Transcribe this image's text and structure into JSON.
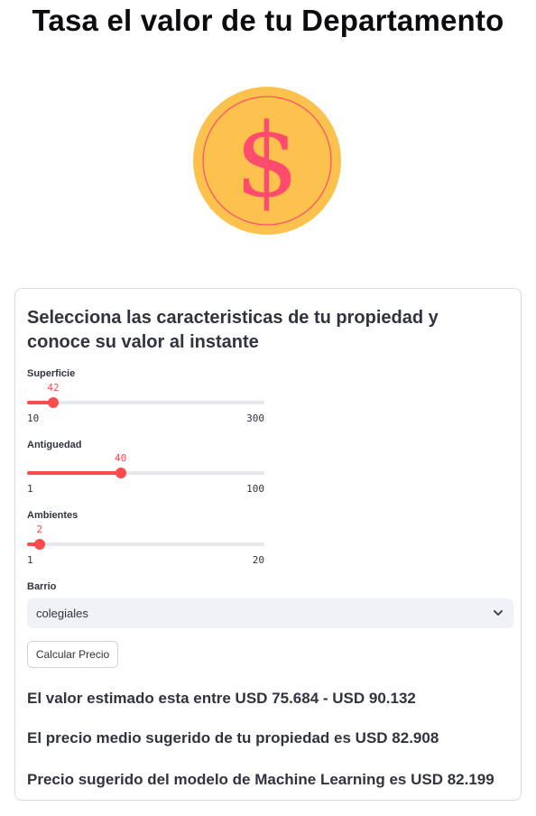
{
  "page": {
    "title": "Tasa el valor de tu Departamento",
    "image_icon": "dollar-coin-icon",
    "image_colors": {
      "coin": "#fcc24d",
      "symbol": "#ff4b6e"
    }
  },
  "form": {
    "heading": "Selecciona las caracteristicas de tu propiedad y conoce su valor al instante",
    "accent_color": "#ff4b4b",
    "sliders": [
      {
        "label": "Superficie",
        "value": 42,
        "min": 10,
        "max": 300
      },
      {
        "label": "Antiguedad",
        "value": 40,
        "min": 1,
        "max": 100
      },
      {
        "label": "Ambientes",
        "value": 2,
        "min": 1,
        "max": 20
      }
    ],
    "barrio": {
      "label": "Barrio",
      "selected": "colegiales",
      "icon": "chevron-down-icon"
    },
    "button_label": "Calcular Precio"
  },
  "results": {
    "range_text": "El valor estimado esta entre USD 75.684 - USD 90.132",
    "median_text": "El precio medio sugerido de tu propiedad es USD 82.908",
    "ml_text": "Precio sugerido del modelo de Machine Learning es USD 82.199"
  }
}
